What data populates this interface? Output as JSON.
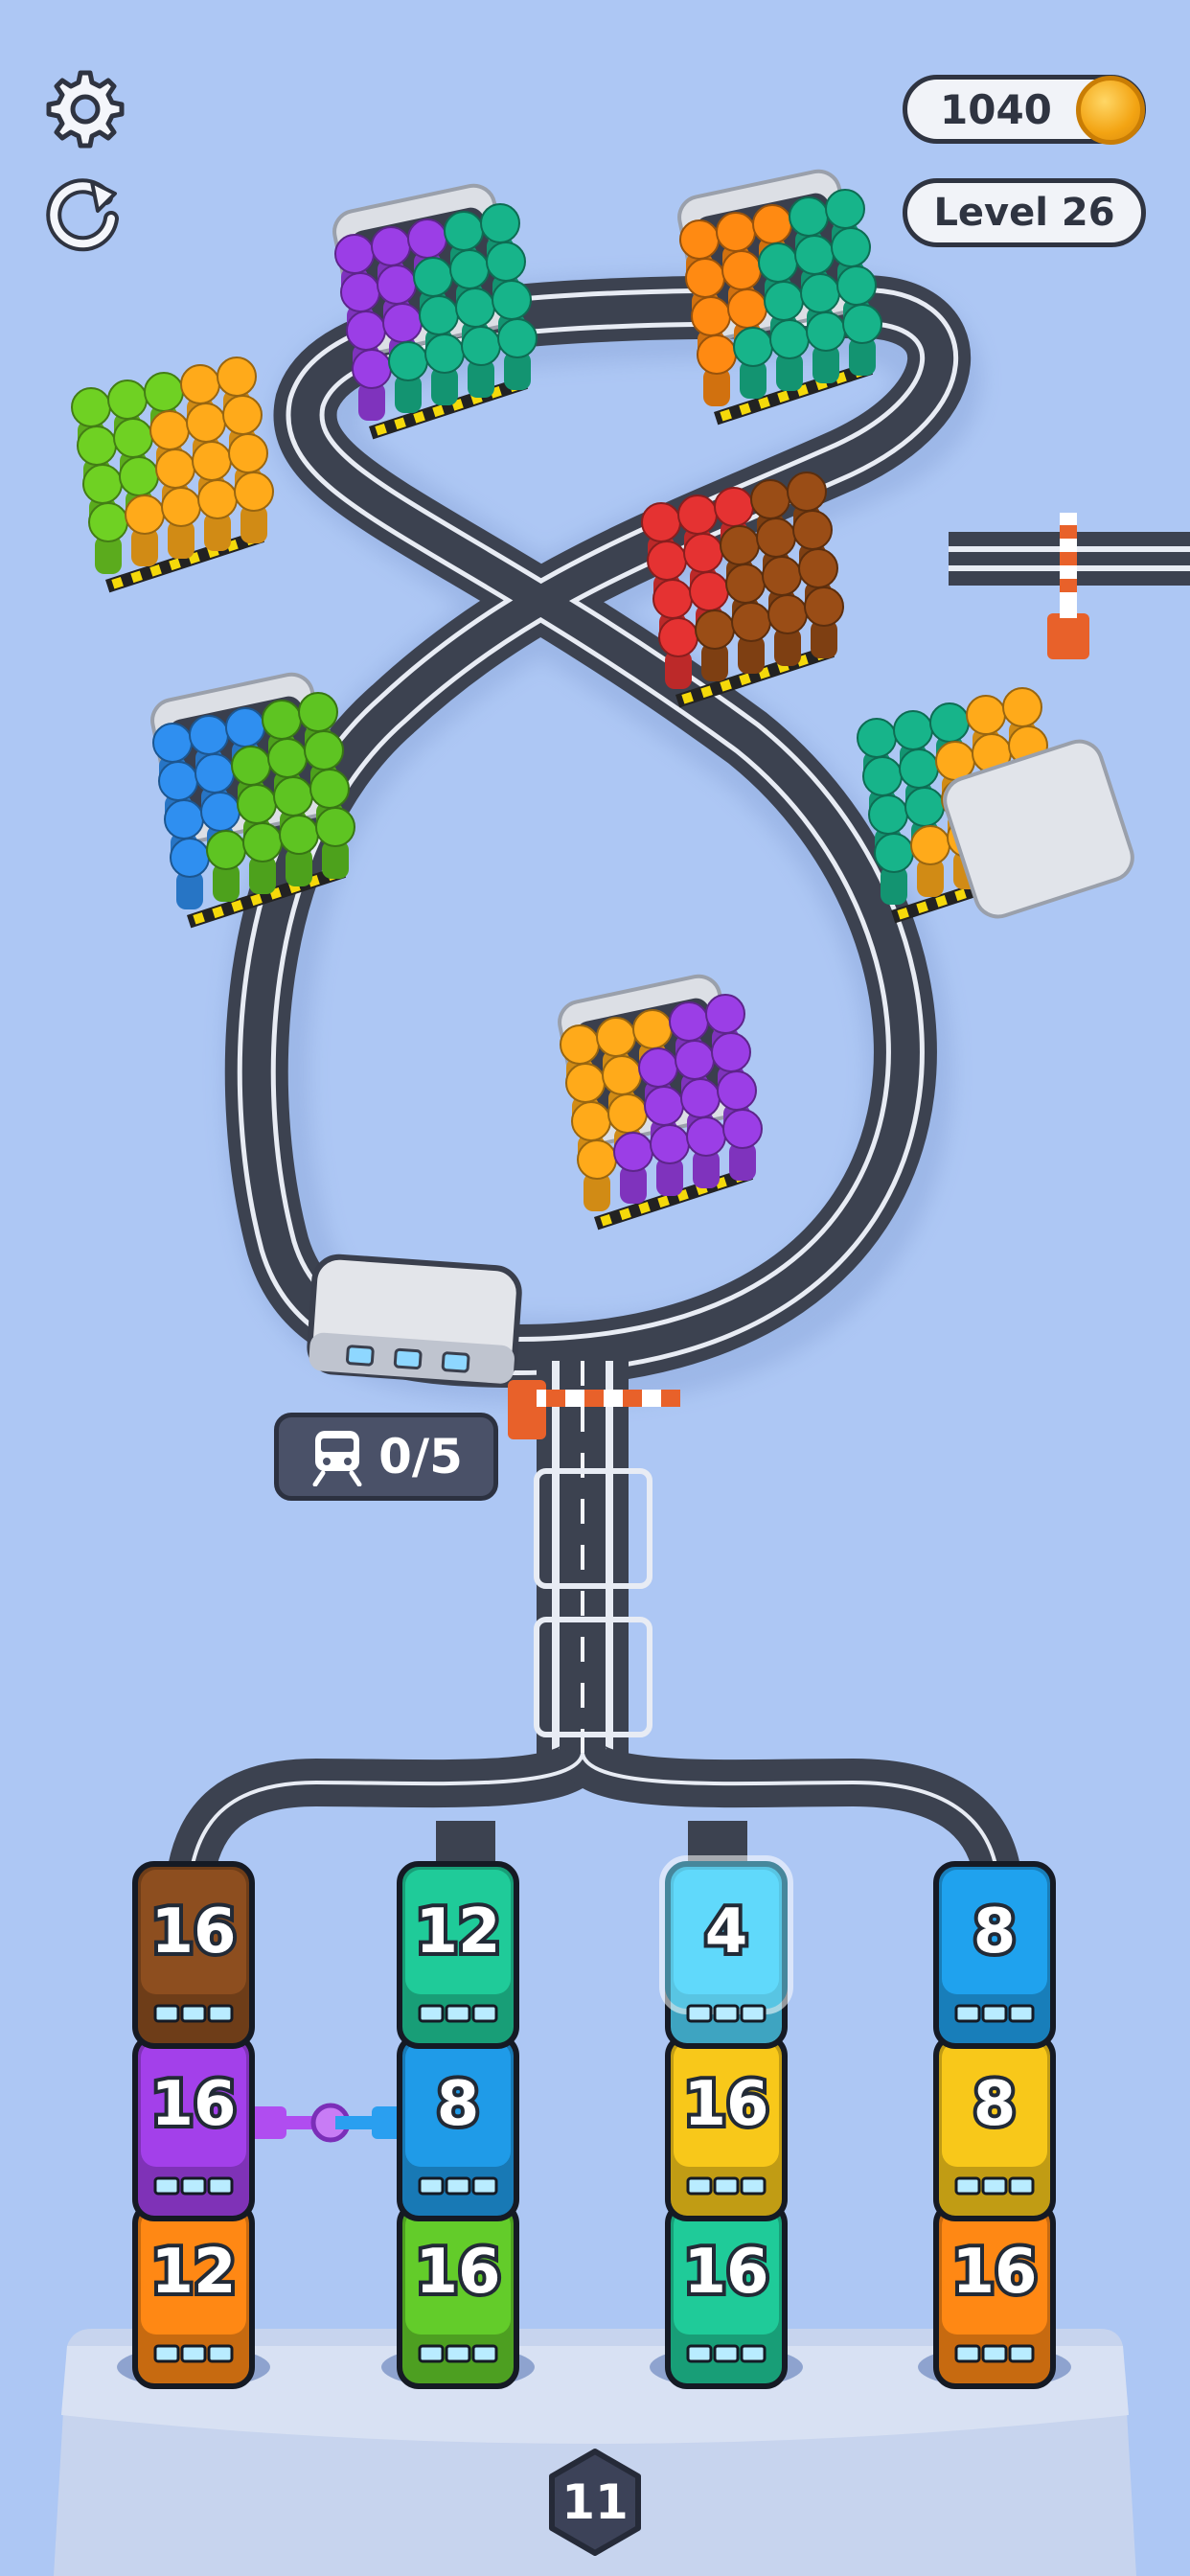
{
  "hud": {
    "settings_icon": "gear-icon",
    "restart_icon": "restart-icon",
    "coins": "1040",
    "level": "Level 26"
  },
  "train_counter": {
    "icon": "train-icon",
    "text": "0/5"
  },
  "stations": [
    {
      "colors": [
        "#9b3ee6",
        "#17b48a"
      ]
    },
    {
      "colors": [
        "#ff8a12",
        "#17b48a"
      ]
    },
    {
      "colors": [
        "#6fd123",
        "#ffaa1a"
      ]
    },
    {
      "colors": [
        "#e53232",
        "#9a4d16"
      ]
    },
    {
      "colors": [
        "#2f8ff0",
        "#5ec422"
      ]
    },
    {
      "colors": [
        "#17b48a",
        "#ffaa1a"
      ]
    },
    {
      "colors": [
        "#ffaa1a",
        "#9b3ee6"
      ]
    }
  ],
  "wagon_columns": [
    {
      "cars": [
        {
          "num": "16",
          "color": "#8d4e1f"
        },
        {
          "num": "16",
          "color": "#a340ea"
        },
        {
          "num": "12",
          "color": "#ff8814"
        }
      ]
    },
    {
      "cars": [
        {
          "num": "12",
          "color": "#1fcb99"
        },
        {
          "num": "8",
          "color": "#1f9be8"
        },
        {
          "num": "16",
          "color": "#63cc2a"
        }
      ]
    },
    {
      "cars": [
        {
          "num": "4",
          "color": "#4fd2f7"
        },
        {
          "num": "16",
          "color": "#f8c81a"
        },
        {
          "num": "16",
          "color": "#1fcb99"
        }
      ]
    },
    {
      "cars": [
        {
          "num": "8",
          "color": "#1fa2ee"
        },
        {
          "num": "8",
          "color": "#f8c81a"
        },
        {
          "num": "16",
          "color": "#ff8814"
        }
      ]
    }
  ],
  "bottom_badge": "11",
  "colors": {
    "background": "#adc7f4",
    "track": "#3c4250",
    "track_rail": "#e8ecf4",
    "barrier": "#e8612a",
    "tray": "#c7d4ee"
  }
}
